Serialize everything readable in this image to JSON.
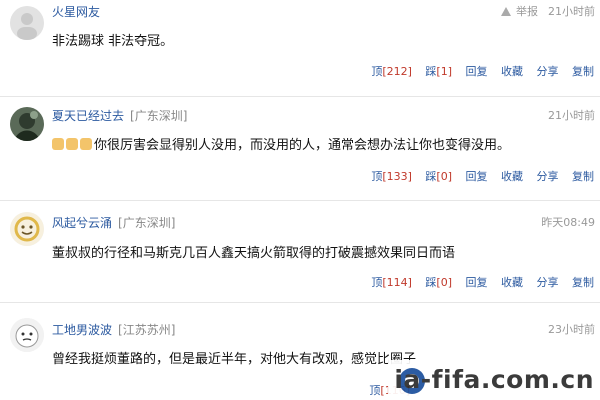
{
  "comments": [
    {
      "user": "火星网友",
      "location": "",
      "time": "21小时前",
      "report_label": "举报",
      "content": "非法踢球 非法夺冠。",
      "actions": {
        "up": "顶",
        "up_count": "[212]",
        "down": "踩",
        "down_count": "[1]",
        "reply": "回复",
        "favorite": "收藏",
        "share": "分享",
        "copy": "复制"
      }
    },
    {
      "user": "夏天已经过去",
      "location": "[广东深圳]",
      "time": "21小时前",
      "content": "你很厉害会显得别人没用，而没用的人，通常会想办法让你也变得没用。",
      "emoji": [
        "thumbs-up-icon",
        "thumbs-up-icon",
        "thumbs-up-icon"
      ],
      "actions": {
        "up": "顶",
        "up_count": "[133]",
        "down": "踩",
        "down_count": "[0]",
        "reply": "回复",
        "favorite": "收藏",
        "share": "分享",
        "copy": "复制"
      }
    },
    {
      "user": "风起兮云涌",
      "location": "[广东深圳]",
      "time": "昨天08:49",
      "content": "董叔叔的行径和马斯克几百人鑫天搞火箭取得的打破震撼效果同日而语",
      "actions": {
        "up": "顶",
        "up_count": "[114]",
        "down": "踩",
        "down_count": "[0]",
        "reply": "回复",
        "favorite": "收藏",
        "share": "分享",
        "copy": "复制"
      }
    },
    {
      "user": "工地男波波",
      "location": "[江苏苏州]",
      "time": "23小时前",
      "content": "曾经我挺烦董路的，但是最近半年，对他大有改观，感觉比圈子",
      "actions": {
        "up": "顶",
        "up_count": "[116]"
      }
    }
  ],
  "watermark": {
    "text": "ia-fifa.com.cn"
  }
}
